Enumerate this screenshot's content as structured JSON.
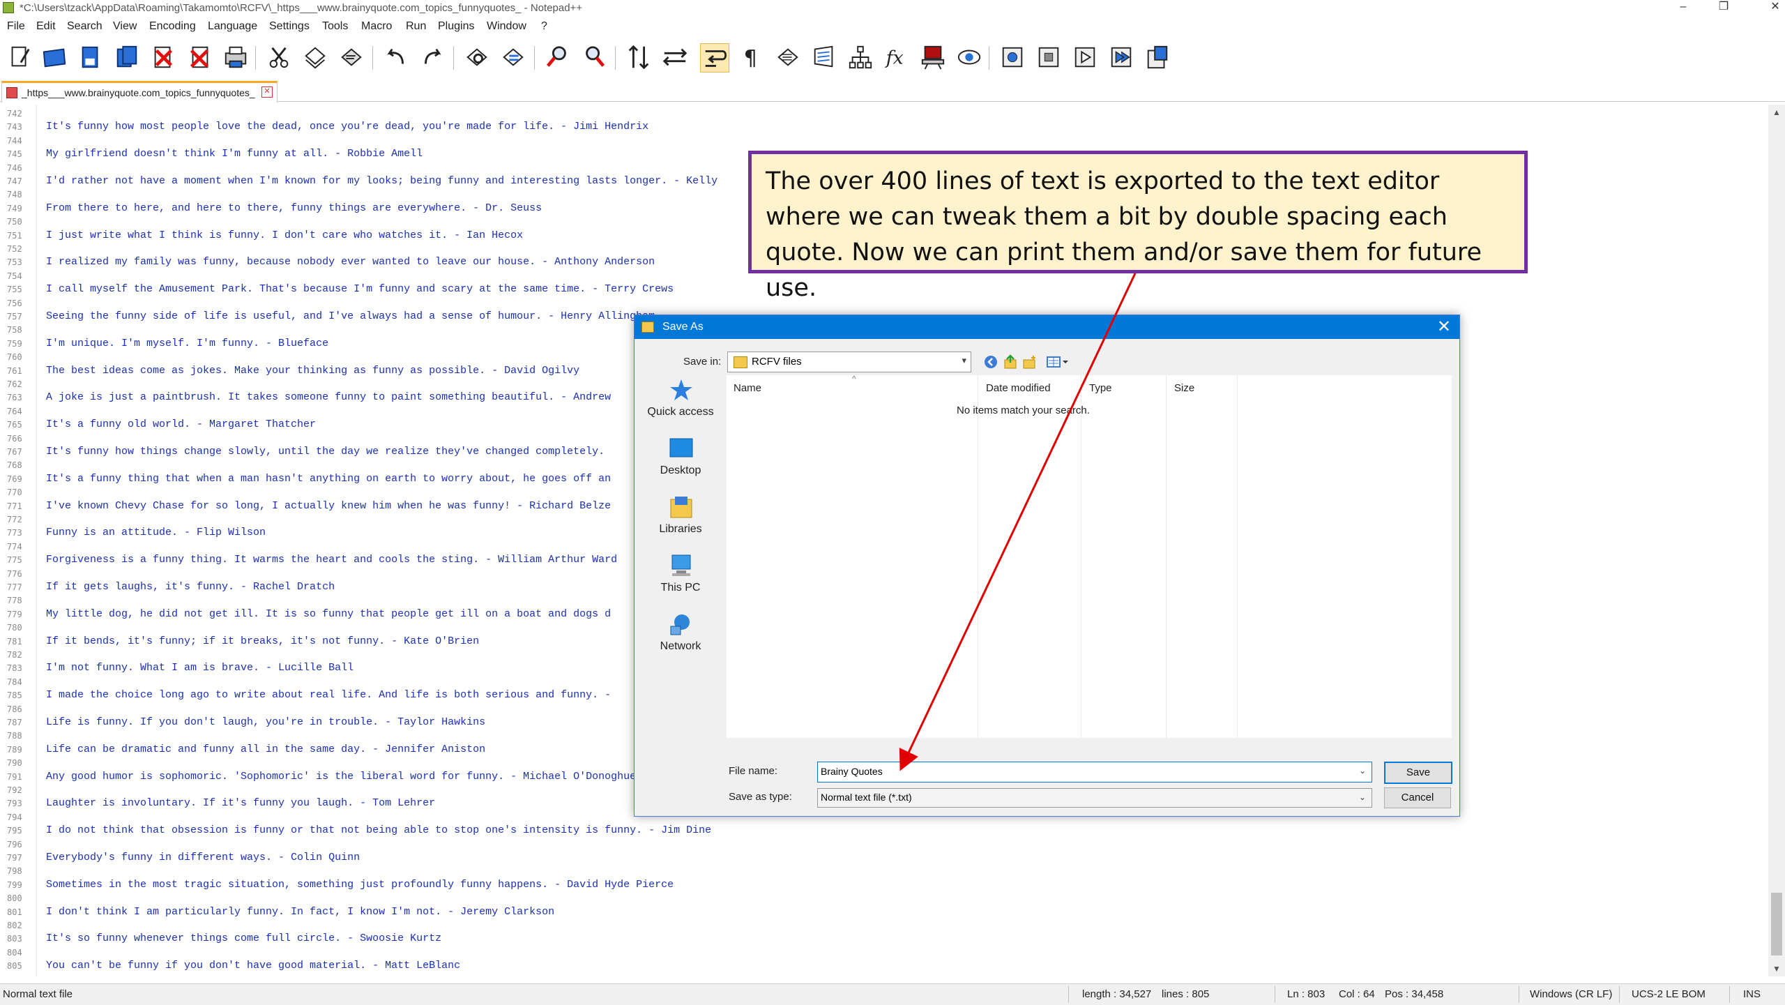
{
  "window": {
    "title": "*C:\\Users\\tzack\\AppData\\Roaming\\Takamomto\\RCFV\\_https___www.brainyquote.com_topics_funnyquotes_ - Notepad++"
  },
  "menu": [
    "File",
    "Edit",
    "Search",
    "View",
    "Encoding",
    "Language",
    "Settings",
    "Tools",
    "Macro",
    "Run",
    "Plugins",
    "Window",
    "?"
  ],
  "tab": {
    "label": "_https___www.brainyquote.com_topics_funnyquotes_"
  },
  "editor": {
    "lines": [
      {
        "n": "742",
        "t": ""
      },
      {
        "n": "743",
        "t": "It's funny how most people love the dead, once you're dead, you're made for life. - Jimi Hendrix"
      },
      {
        "n": "744",
        "t": ""
      },
      {
        "n": "745",
        "t": "My girlfriend doesn't think I'm funny at all. - Robbie Amell"
      },
      {
        "n": "746",
        "t": ""
      },
      {
        "n": "747",
        "t": "I'd rather not have a moment when I'm known for my looks; being funny and interesting lasts longer. - Kelly"
      },
      {
        "n": "748",
        "t": ""
      },
      {
        "n": "749",
        "t": "From there to here, and here to there, funny things are everywhere. - Dr. Seuss"
      },
      {
        "n": "750",
        "t": ""
      },
      {
        "n": "751",
        "t": "I just write what I think is funny. I don't care who watches it. - Ian Hecox"
      },
      {
        "n": "752",
        "t": ""
      },
      {
        "n": "753",
        "t": "I realized my family was funny, because nobody ever wanted to leave our house. - Anthony Anderson"
      },
      {
        "n": "754",
        "t": ""
      },
      {
        "n": "755",
        "t": "I call myself the Amusement Park. That's because I'm funny and scary at the same time. - Terry Crews"
      },
      {
        "n": "756",
        "t": ""
      },
      {
        "n": "757",
        "t": "Seeing the funny side of life is useful, and I've always had a sense of humour. - Henry Allingham"
      },
      {
        "n": "758",
        "t": ""
      },
      {
        "n": "759",
        "t": "I'm unique. I'm myself. I'm funny. - Blueface"
      },
      {
        "n": "760",
        "t": ""
      },
      {
        "n": "761",
        "t": "The best ideas come as jokes. Make your thinking as funny as possible. - David Ogilvy"
      },
      {
        "n": "762",
        "t": ""
      },
      {
        "n": "763",
        "t": "A joke is just a paintbrush. It takes someone funny to paint something beautiful. - Andrew"
      },
      {
        "n": "764",
        "t": ""
      },
      {
        "n": "765",
        "t": "It's a funny old world. - Margaret Thatcher"
      },
      {
        "n": "766",
        "t": ""
      },
      {
        "n": "767",
        "t": "It's funny how things change slowly, until the day we realize they've changed completely."
      },
      {
        "n": "768",
        "t": ""
      },
      {
        "n": "769",
        "t": "It's a funny thing that when a man hasn't anything on earth to worry about, he goes off an"
      },
      {
        "n": "770",
        "t": ""
      },
      {
        "n": "771",
        "t": "I've known Chevy Chase for so long, I actually knew him when he was funny! - Richard Belze"
      },
      {
        "n": "772",
        "t": ""
      },
      {
        "n": "773",
        "t": "Funny is an attitude. - Flip Wilson"
      },
      {
        "n": "774",
        "t": ""
      },
      {
        "n": "775",
        "t": "Forgiveness is a funny thing. It warms the heart and cools the sting. - William Arthur Ward"
      },
      {
        "n": "776",
        "t": ""
      },
      {
        "n": "777",
        "t": "If it gets laughs, it's funny. - Rachel Dratch"
      },
      {
        "n": "778",
        "t": ""
      },
      {
        "n": "779",
        "t": "My little dog, he did not get ill. It is so funny that people get ill on a boat and dogs d"
      },
      {
        "n": "780",
        "t": ""
      },
      {
        "n": "781",
        "t": "If it bends, it's funny; if it breaks, it's not funny. - Kate O'Brien"
      },
      {
        "n": "782",
        "t": ""
      },
      {
        "n": "783",
        "t": "I'm not funny. What I am is brave. - Lucille Ball"
      },
      {
        "n": "784",
        "t": ""
      },
      {
        "n": "785",
        "t": "I made the choice long ago to write about real life. And life is both serious and funny. -"
      },
      {
        "n": "786",
        "t": ""
      },
      {
        "n": "787",
        "t": "Life is funny. If you don't laugh, you're in trouble. - Taylor Hawkins"
      },
      {
        "n": "788",
        "t": ""
      },
      {
        "n": "789",
        "t": "Life can be dramatic and funny all in the same day. - Jennifer Aniston"
      },
      {
        "n": "790",
        "t": ""
      },
      {
        "n": "791",
        "t": "Any good humor is sophomoric. 'Sophomoric' is the liberal word for funny. - Michael O'Donoghue"
      },
      {
        "n": "792",
        "t": ""
      },
      {
        "n": "793",
        "t": "Laughter is involuntary. If it's funny you laugh. - Tom Lehrer"
      },
      {
        "n": "794",
        "t": ""
      },
      {
        "n": "795",
        "t": "I do not think that obsession is funny or that not being able to stop one's intensity is funny. - Jim Dine"
      },
      {
        "n": "796",
        "t": ""
      },
      {
        "n": "797",
        "t": "Everybody's funny in different ways. - Colin Quinn"
      },
      {
        "n": "798",
        "t": ""
      },
      {
        "n": "799",
        "t": "Sometimes in the most tragic situation, something just profoundly funny happens. - David Hyde Pierce"
      },
      {
        "n": "800",
        "t": ""
      },
      {
        "n": "801",
        "t": "I don't think I am particularly funny. In fact, I know I'm not. - Jeremy Clarkson"
      },
      {
        "n": "802",
        "t": ""
      },
      {
        "n": "803",
        "t": "It's so funny whenever things come full circle. - Swoosie Kurtz"
      },
      {
        "n": "804",
        "t": ""
      },
      {
        "n": "805",
        "t": "You can't be funny if you don't have good material. - Matt LeBlanc"
      }
    ]
  },
  "callout": {
    "text": "The over 400 lines of text is exported to the text editor where we can tweak them a bit by double spacing each quote.  Now we can print them and/or save them for future use."
  },
  "dialog": {
    "title": "Save As",
    "save_in_label": "Save in:",
    "save_in_value": "RCFV files",
    "places": [
      "Quick access",
      "Desktop",
      "Libraries",
      "This PC",
      "Network"
    ],
    "columns": [
      "Name",
      "Date modified",
      "Type",
      "Size"
    ],
    "empty_message": "No items match your search.",
    "file_name_label": "File name:",
    "file_name_value": "Brainy Quotes",
    "save_type_label": "Save as type:",
    "save_type_value": "Normal text file (*.txt)",
    "save_button": "Save",
    "cancel_button": "Cancel"
  },
  "status": {
    "doc_type": "Normal text file",
    "length": "length : 34,527",
    "lines": "lines : 805",
    "ln": "Ln : 803",
    "col": "Col : 64",
    "pos": "Pos : 34,458",
    "eol": "Windows (CR LF)",
    "encoding": "UCS-2 LE BOM",
    "mode": "INS"
  },
  "toolbar_icons": [
    "new-file",
    "open-file",
    "save",
    "save-all",
    "close",
    "close-all",
    "print",
    "cut",
    "copy",
    "paste",
    "undo",
    "redo",
    "find",
    "replace",
    "zoom-in",
    "zoom-out",
    "sync-vertical",
    "sync-horizontal",
    "word-wrap",
    "show-all-chars",
    "indent-guide",
    "udl",
    "document-map",
    "function-list",
    "folder-workspace",
    "monitoring",
    "record-macro",
    "stop-macro",
    "play-macro",
    "run-macro-multiple",
    "save-macro"
  ],
  "colors": {
    "accent": "#0078d7",
    "callout_bg": "#fff2cc",
    "callout_border": "#7030a0",
    "code_text": "#1a2fb5",
    "arrow": "#e00000"
  }
}
